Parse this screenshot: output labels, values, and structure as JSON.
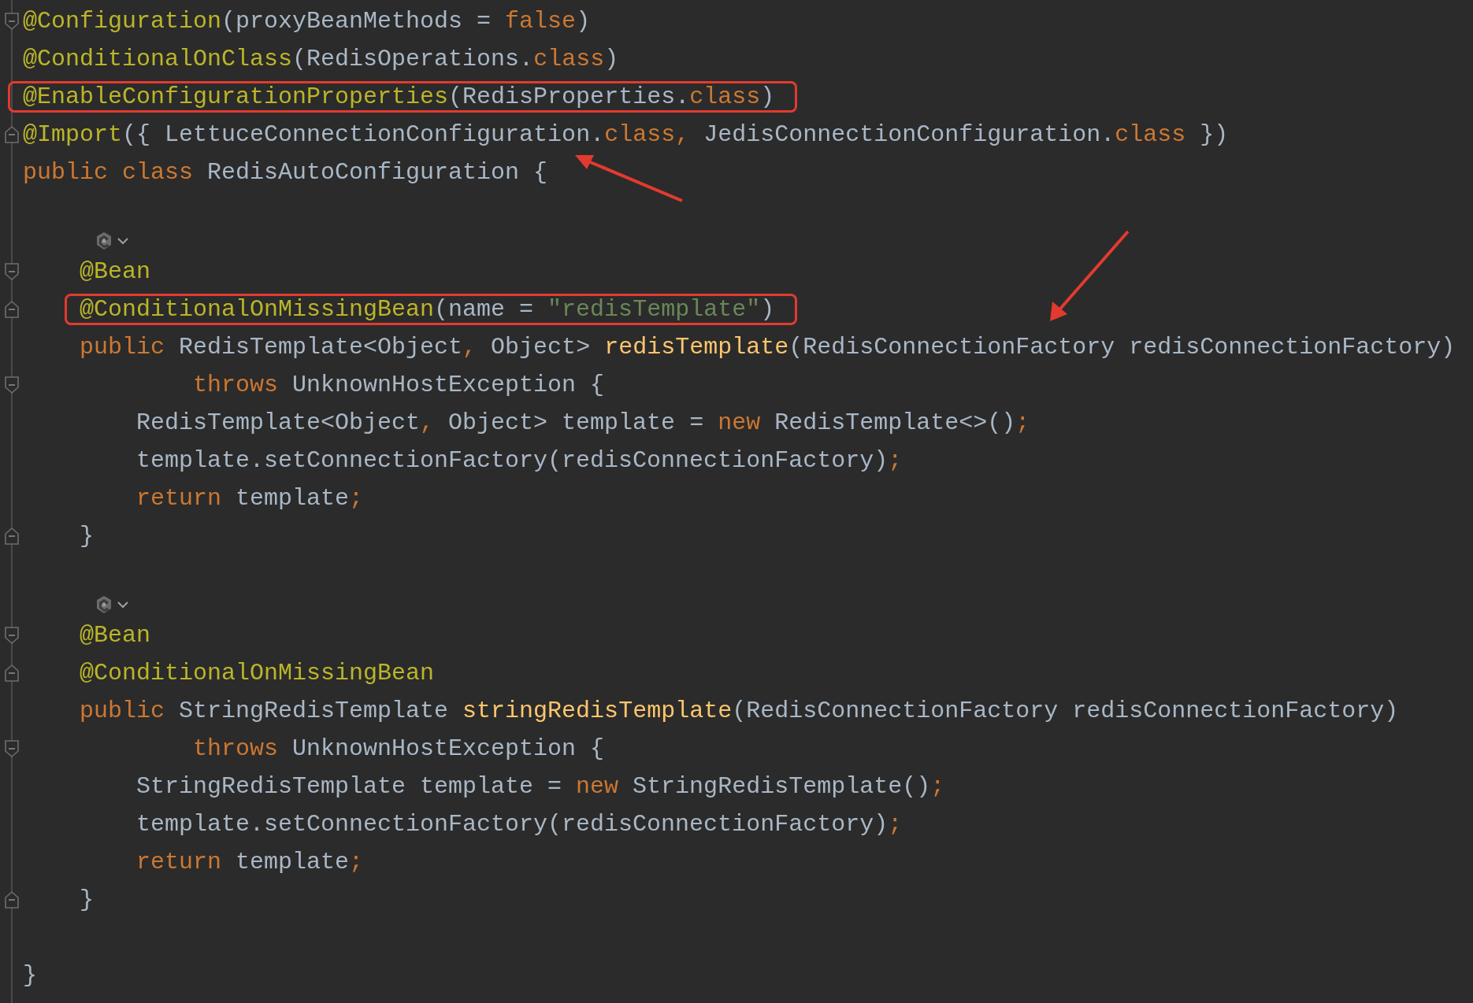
{
  "editor": {
    "lines": [
      {
        "kind": "code",
        "fold_start": true,
        "fold_end": false,
        "boxed": false,
        "tokens": [
          {
            "kind": "annotation",
            "text": "@Configuration"
          },
          {
            "kind": "plain",
            "text": "(proxyBeanMethods = "
          },
          {
            "kind": "keyword",
            "text": "false"
          },
          {
            "kind": "plain",
            "text": ")"
          }
        ]
      },
      {
        "kind": "code",
        "fold_start": false,
        "fold_end": false,
        "boxed": false,
        "tokens": [
          {
            "kind": "annotation",
            "text": "@ConditionalOnClass"
          },
          {
            "kind": "plain",
            "text": "(RedisOperations."
          },
          {
            "kind": "keyword",
            "text": "class"
          },
          {
            "kind": "plain",
            "text": ")"
          }
        ]
      },
      {
        "kind": "code",
        "fold_start": false,
        "fold_end": false,
        "boxed": true,
        "tokens": [
          {
            "kind": "annotation",
            "text": "@EnableConfigurationProperties"
          },
          {
            "kind": "plain",
            "text": "(RedisProperties."
          },
          {
            "kind": "keyword",
            "text": "class"
          },
          {
            "kind": "plain",
            "text": ")"
          }
        ]
      },
      {
        "kind": "code",
        "fold_start": false,
        "fold_end": true,
        "boxed": false,
        "tokens": [
          {
            "kind": "annotation",
            "text": "@Import"
          },
          {
            "kind": "plain",
            "text": "({ LettuceConnectionConfiguration."
          },
          {
            "kind": "keyword",
            "text": "class, "
          },
          {
            "kind": "plain",
            "text": "JedisConnectionConfiguration."
          },
          {
            "kind": "keyword",
            "text": "class"
          },
          {
            "kind": "plain",
            "text": " })"
          }
        ]
      },
      {
        "kind": "code",
        "fold_start": false,
        "fold_end": false,
        "boxed": false,
        "arrow_up_left": true,
        "arrow_down_left": false,
        "tokens": [
          {
            "kind": "keyword",
            "text": "public class "
          },
          {
            "kind": "plain",
            "text": "RedisAutoConfiguration {"
          }
        ],
        "children": [
          {
            "kind": "blank"
          },
          {
            "kind": "marker"
          },
          {
            "kind": "code",
            "fold_start": true,
            "fold_end": false,
            "boxed": false,
            "tokens": [
              {
                "kind": "annotation",
                "text": "@Bean"
              }
            ]
          },
          {
            "kind": "code",
            "fold_start": false,
            "fold_end": true,
            "boxed": true,
            "arrow_up_left": false,
            "arrow_down_left": true,
            "tokens": [
              {
                "kind": "annotation",
                "text": "@ConditionalOnMissingBean"
              },
              {
                "kind": "plain",
                "text": "(name = "
              },
              {
                "kind": "string",
                "text": "\"redisTemplate\""
              },
              {
                "kind": "plain",
                "text": ")"
              }
            ]
          },
          {
            "kind": "code",
            "fold_start": false,
            "fold_end": false,
            "boxed": false,
            "tokens": [
              {
                "kind": "keyword",
                "text": "public "
              },
              {
                "kind": "plain",
                "text": "RedisTemplate<Object"
              },
              {
                "kind": "keyword",
                "text": ", "
              },
              {
                "kind": "plain",
                "text": "Object> "
              },
              {
                "kind": "method",
                "text": "redisTemplate"
              },
              {
                "kind": "plain",
                "text": "(RedisConnectionFactory redisConnectionFactory)"
              }
            ],
            "children": [
              {
                "kind": "continuation",
                "fold_start": true,
                "fold_end": false,
                "boxed": false,
                "tokens": [
                  {
                    "kind": "keyword",
                    "text": "throws "
                  },
                  {
                    "kind": "plain",
                    "text": "UnknownHostException {"
                  }
                ]
              },
              {
                "kind": "code",
                "fold_start": false,
                "fold_end": false,
                "boxed": false,
                "tokens": [
                  {
                    "kind": "plain",
                    "text": "RedisTemplate<Object"
                  },
                  {
                    "kind": "keyword",
                    "text": ", "
                  },
                  {
                    "kind": "plain",
                    "text": "Object> template = "
                  },
                  {
                    "kind": "keyword",
                    "text": "new "
                  },
                  {
                    "kind": "plain",
                    "text": "RedisTemplate<>()"
                  },
                  {
                    "kind": "keyword",
                    "text": ";"
                  }
                ]
              },
              {
                "kind": "code",
                "fold_start": false,
                "fold_end": false,
                "boxed": false,
                "tokens": [
                  {
                    "kind": "plain",
                    "text": "template.setConnectionFactory(redisConnectionFactory)"
                  },
                  {
                    "kind": "keyword",
                    "text": ";"
                  }
                ]
              },
              {
                "kind": "code",
                "fold_start": false,
                "fold_end": false,
                "boxed": false,
                "tokens": [
                  {
                    "kind": "keyword",
                    "text": "return "
                  },
                  {
                    "kind": "plain",
                    "text": "template"
                  },
                  {
                    "kind": "keyword",
                    "text": ";"
                  }
                ]
              }
            ]
          },
          {
            "kind": "code",
            "fold_start": false,
            "fold_end": true,
            "boxed": false,
            "tokens": [
              {
                "kind": "plain",
                "text": "}"
              }
            ]
          },
          {
            "kind": "blank"
          },
          {
            "kind": "marker"
          },
          {
            "kind": "code",
            "fold_start": true,
            "fold_end": false,
            "boxed": false,
            "tokens": [
              {
                "kind": "annotation",
                "text": "@Bean"
              }
            ]
          },
          {
            "kind": "code",
            "fold_start": false,
            "fold_end": true,
            "boxed": false,
            "tokens": [
              {
                "kind": "annotation",
                "text": "@ConditionalOnMissingBean"
              }
            ]
          },
          {
            "kind": "code",
            "fold_start": false,
            "fold_end": false,
            "boxed": false,
            "tokens": [
              {
                "kind": "keyword",
                "text": "public "
              },
              {
                "kind": "plain",
                "text": "StringRedisTemplate "
              },
              {
                "kind": "method",
                "text": "stringRedisTemplate"
              },
              {
                "kind": "plain",
                "text": "(RedisConnectionFactory redisConnectionFactory)"
              }
            ],
            "children": [
              {
                "kind": "continuation",
                "fold_start": true,
                "fold_end": false,
                "boxed": false,
                "tokens": [
                  {
                    "kind": "keyword",
                    "text": "throws "
                  },
                  {
                    "kind": "plain",
                    "text": "UnknownHostException {"
                  }
                ]
              },
              {
                "kind": "code",
                "fold_start": false,
                "fold_end": false,
                "boxed": false,
                "tokens": [
                  {
                    "kind": "plain",
                    "text": "StringRedisTemplate template = "
                  },
                  {
                    "kind": "keyword",
                    "text": "new "
                  },
                  {
                    "kind": "plain",
                    "text": "StringRedisTemplate()"
                  },
                  {
                    "kind": "keyword",
                    "text": ";"
                  }
                ]
              },
              {
                "kind": "code",
                "fold_start": false,
                "fold_end": false,
                "boxed": false,
                "tokens": [
                  {
                    "kind": "plain",
                    "text": "template.setConnectionFactory(redisConnectionFactory)"
                  },
                  {
                    "kind": "keyword",
                    "text": ";"
                  }
                ]
              },
              {
                "kind": "code",
                "fold_start": false,
                "fold_end": false,
                "boxed": false,
                "tokens": [
                  {
                    "kind": "keyword",
                    "text": "return "
                  },
                  {
                    "kind": "plain",
                    "text": "template"
                  },
                  {
                    "kind": "keyword",
                    "text": ";"
                  }
                ]
              }
            ]
          },
          {
            "kind": "code",
            "fold_start": false,
            "fold_end": true,
            "boxed": false,
            "tokens": [
              {
                "kind": "plain",
                "text": "}"
              }
            ]
          }
        ]
      },
      {
        "kind": "blank"
      },
      {
        "kind": "code",
        "fold_start": false,
        "fold_end": false,
        "boxed": false,
        "tokens": [
          {
            "kind": "plain",
            "text": "}"
          }
        ]
      }
    ]
  }
}
